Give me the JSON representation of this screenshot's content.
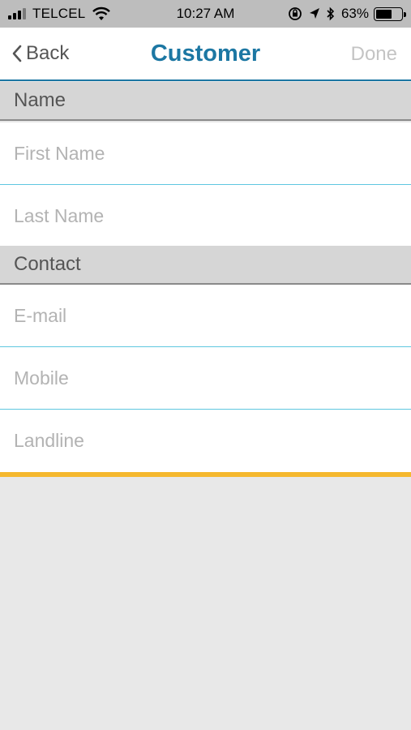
{
  "status_bar": {
    "carrier": "TELCEL",
    "time": "10:27 AM",
    "battery_percent": "63%",
    "battery_level": 0.63,
    "signal_bars_filled": 3,
    "signal_bars_total": 4
  },
  "nav": {
    "back_label": "Back",
    "title": "Customer",
    "done_label": "Done"
  },
  "sections": {
    "name": {
      "header": "Name",
      "first_name_placeholder": "First Name",
      "last_name_placeholder": "Last Name"
    },
    "contact": {
      "header": "Contact",
      "email_placeholder": "E-mail",
      "mobile_placeholder": "Mobile",
      "landline_placeholder": "Landline"
    }
  },
  "colors": {
    "accent_blue": "#1c77a3",
    "field_divider": "#5fc7e0",
    "accent_yellow": "#f5b82e",
    "section_header_bg": "#d6d6d6"
  }
}
